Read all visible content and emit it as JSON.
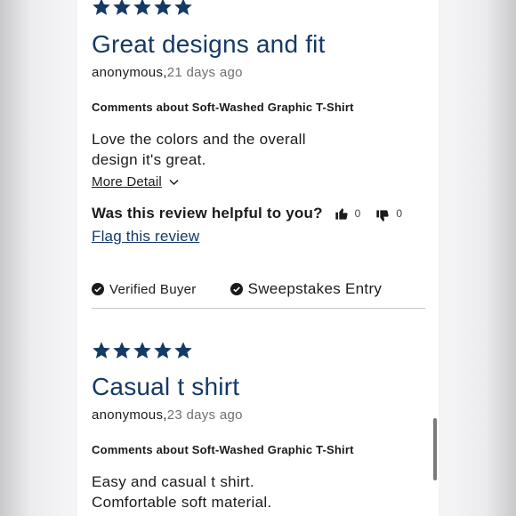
{
  "reviews": [
    {
      "rating": 5,
      "title": "Great designs and fit",
      "author": "anonymous,",
      "date": "21 days ago",
      "comment_heading": "Comments about Soft-Washed Graphic T-Shirt",
      "body_line1": "Love the colors and the overall",
      "body_line2": "design it's great.",
      "more_label": "More Detail",
      "helpful_question": "Was this review helpful to you?",
      "upvotes": "0",
      "downvotes": "0",
      "flag_label": "Flag this review",
      "badge_verified": "Verified Buyer",
      "badge_sweepstakes": "Sweepstakes Entry"
    },
    {
      "rating": 5,
      "title": "Casual t shirt",
      "author": "anonymous,",
      "date": "23 days ago",
      "comment_heading": "Comments about Soft-Washed Graphic T-Shirt",
      "body_line1": "Easy and casual t shirt.",
      "body_line2": "Comfortable soft material."
    }
  ],
  "colors": {
    "accent": "#143a66",
    "text": "#1b1b1b",
    "muted": "#6e6e6e"
  },
  "icons": [
    "star-icon",
    "chevron-down-icon",
    "thumbs-up-icon",
    "thumbs-down-icon",
    "check-circle-icon"
  ]
}
